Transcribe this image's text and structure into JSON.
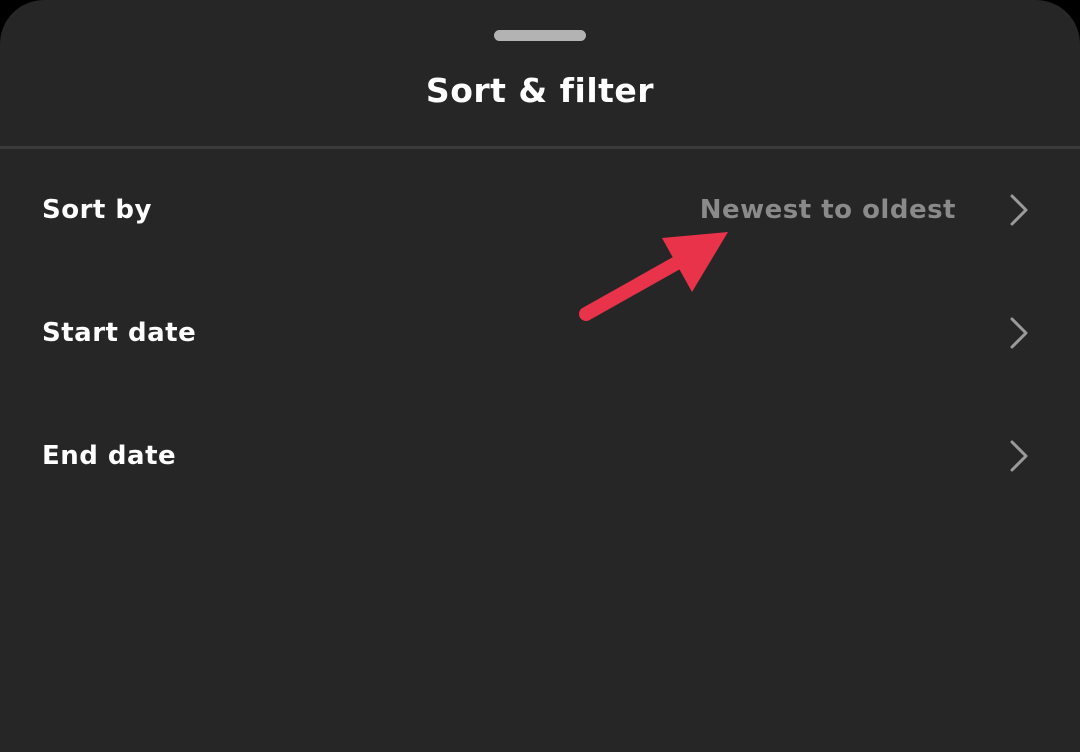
{
  "sheet": {
    "title": "Sort & filter"
  },
  "rows": [
    {
      "label": "Sort by",
      "value": "Newest to oldest"
    },
    {
      "label": "Start date",
      "value": ""
    },
    {
      "label": "End date",
      "value": ""
    }
  ],
  "colors": {
    "background": "#262626",
    "text_primary": "#ffffff",
    "text_secondary": "#8a8a8a",
    "annotation_arrow": "#e8334a"
  },
  "icons": {
    "row_trailing": "chevron-right-icon",
    "annotation": "red-arrow-icon"
  }
}
